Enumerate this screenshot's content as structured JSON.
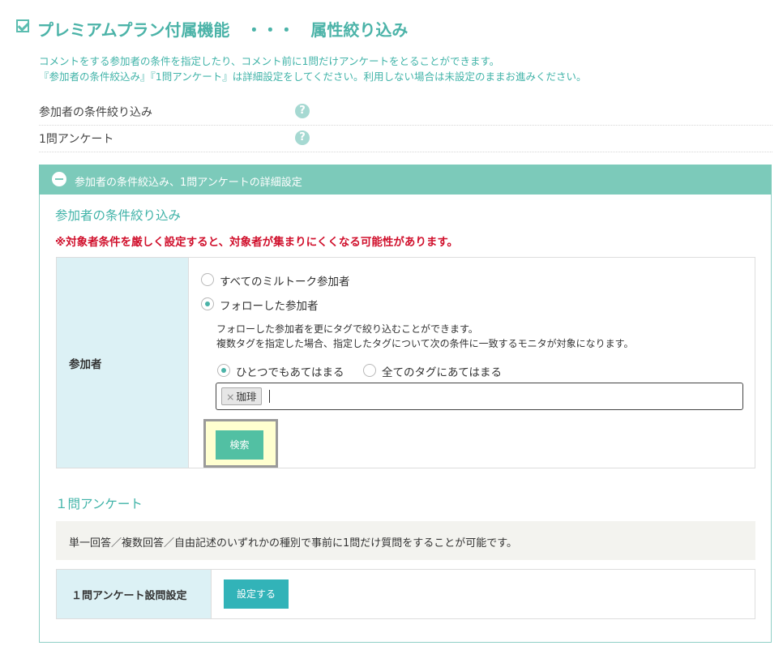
{
  "header": {
    "title": "プレミアムプラン付属機能　・・・　属性絞り込み",
    "intro_line1": "コメントをする参加者の条件を指定したり、コメント前に1問だけアンケートをとることができます。",
    "intro_line2": "『参加者の条件絞込み』『1問アンケート』は詳細設定をしてください。利用しない場合は未設定のままお進みください。"
  },
  "settings_rows": [
    {
      "label": "参加者の条件絞り込み",
      "help": "?"
    },
    {
      "label": "1問アンケート",
      "help": "?"
    }
  ],
  "panel": {
    "title": "参加者の条件絞込み、1問アンケートの詳細設定",
    "filter_section": {
      "title": "参加者の条件絞り込み",
      "warning": "※対象者条件を厳しく設定すると、対象者が集まりにくくなる可能性があります。",
      "row_label": "参加者",
      "radio_all": "すべてのミルトーク参加者",
      "radio_follow": "フォローした参加者",
      "note_line1": "フォローした参加者を更にタグで絞り込むことができます。",
      "note_line2": "複数タグを指定した場合、指定したタグについて次の条件に一致するモニタが対象になります。",
      "match_any": "ひとつでもあてはまる",
      "match_all": "全てのタグにあてはまる",
      "tag_remove": "×",
      "tags": [
        "珈琲"
      ],
      "search_button": "検索"
    },
    "survey_section": {
      "title": "１問アンケート",
      "description": "単一回答／複数回答／自由記述のいずれかの種別で事前に1問だけ質問をすることが可能です。",
      "row_label": "１問アンケート設問設定",
      "set_button": "設定する"
    }
  },
  "colors": {
    "accent": "#4bb3a8",
    "panel_header": "#7ccaba",
    "warning": "#d0102c",
    "label_bg": "#dcf1f5"
  }
}
